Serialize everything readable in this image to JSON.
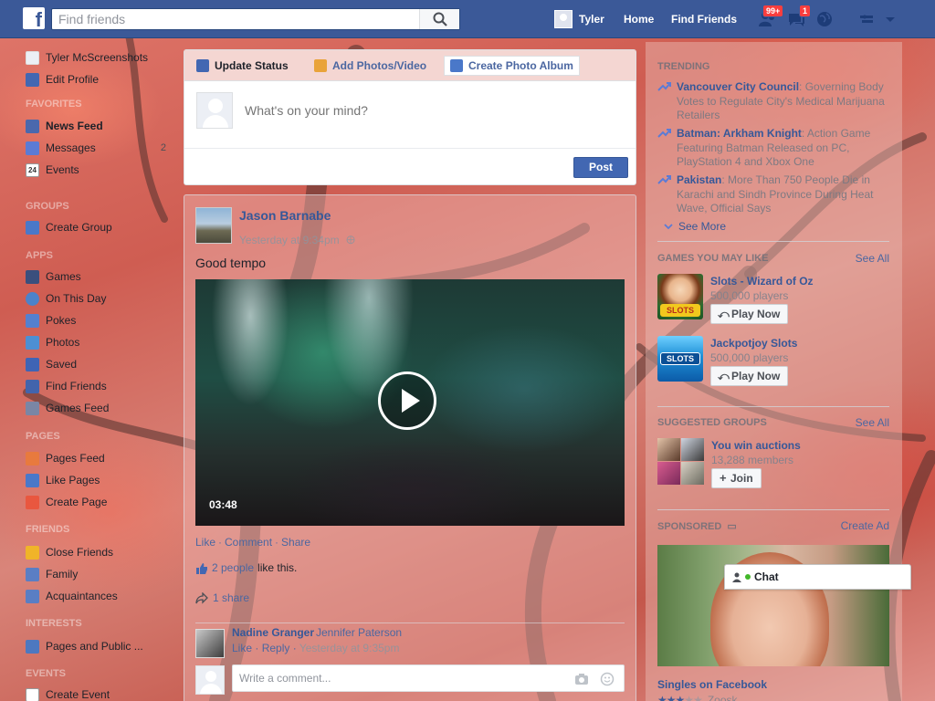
{
  "topbar": {
    "logo": "f",
    "search_placeholder": "Find friends",
    "user_name": "Tyler",
    "home": "Home",
    "find_friends": "Find Friends",
    "friend_requests_badge": "99+",
    "messages_badge": "1",
    "icons": [
      "facebook-logo",
      "search-icon",
      "friend-requests-icon",
      "messages-icon",
      "globe-icon",
      "privacy-icon",
      "caret-down-icon"
    ],
    "brand_color": "#3b5998"
  },
  "left_nav": {
    "profile_name": "Tyler McScreenshots",
    "edit_profile": "Edit Profile",
    "favorites_header": "Favorites",
    "favorites": [
      {
        "label": "News Feed",
        "icon": "news-feed-icon",
        "count": ""
      },
      {
        "label": "Messages",
        "icon": "messages-icon",
        "count": "2"
      },
      {
        "label": "Events",
        "icon": "events-calendar-icon",
        "count": ""
      }
    ],
    "calendar_day": "24",
    "groups_header": "Groups",
    "create_group": "Create Group",
    "apps_header": "Apps",
    "apps": [
      {
        "label": "Games",
        "icon": "games-icon"
      },
      {
        "label": "On This Day",
        "icon": "on-this-day-icon"
      },
      {
        "label": "Pokes",
        "icon": "pokes-icon"
      },
      {
        "label": "Photos",
        "icon": "photos-icon"
      },
      {
        "label": "Saved",
        "icon": "saved-icon"
      },
      {
        "label": "Find Friends",
        "icon": "find-friends-icon"
      },
      {
        "label": "Games Feed",
        "icon": "games-feed-icon"
      }
    ],
    "pages_header": "Pages",
    "pages": [
      {
        "label": "Pages Feed",
        "icon": "pages-feed-icon"
      },
      {
        "label": "Like Pages",
        "icon": "like-pages-icon"
      },
      {
        "label": "Create Page",
        "icon": "create-page-icon"
      }
    ],
    "friends_header": "Friends",
    "friends": [
      {
        "label": "Close Friends",
        "icon": "close-friends-icon"
      },
      {
        "label": "Family",
        "icon": "family-icon"
      },
      {
        "label": "Acquaintances",
        "icon": "acquaintances-icon"
      }
    ],
    "interests_header": "Interests",
    "interests": [
      {
        "label": "Pages and Public ...",
        "icon": "pages-public-icon"
      }
    ],
    "events_header": "Events",
    "create_event": "Create Event"
  },
  "composer": {
    "tab_status": "Update Status",
    "tab_photos": "Add Photos/Video",
    "tab_album": "Create Photo Album",
    "placeholder": "What's on your mind?",
    "post": "Post"
  },
  "story": {
    "author": "Jason Barnabe",
    "time": "Yesterday at 9:34pm",
    "text": "Good tempo",
    "video_duration": "03:48",
    "like": "Like",
    "comment": "Comment",
    "share": "Share",
    "likes_people": "2 people",
    "likes_suffix": "like this.",
    "shares": "1 share",
    "comment_author": "Nadine Granger",
    "comment_text": "Jennifer Paterson",
    "comment_like": "Like",
    "comment_reply": "Reply",
    "comment_time": "Yesterday at 9:35pm",
    "write_placeholder": "Write a comment..."
  },
  "right": {
    "trending_header": "Trending",
    "trending": [
      {
        "topic": "Vancouver City Council",
        "desc": ": Governing Body Votes to Regulate City's Medical Marijuana Retailers"
      },
      {
        "topic": "Batman: Arkham Knight",
        "desc": ": Action Game Featuring Batman Released on PC, PlayStation 4 and Xbox One"
      },
      {
        "topic": "Pakistan",
        "desc": ": More Than 750 People Die in Karachi and Sindh Province During Heat Wave, Official Says"
      }
    ],
    "see_more": "See More",
    "games_header": "Games You May Like",
    "games_see_all": "See All",
    "games": [
      {
        "name": "Slots - Wizard of Oz",
        "players": "500,000 players",
        "button": "Play Now",
        "icon_text": "SLOTS"
      },
      {
        "name": "Jackpotjoy Slots",
        "players": "500,000 players",
        "button": "Play Now",
        "icon_text": "SLOTS"
      }
    ],
    "groups_header": "Suggested Groups",
    "groups_see_all": "See All",
    "group_name": "You win auctions",
    "group_members": "13,288 members",
    "join": "Join",
    "sponsored_header": "Sponsored",
    "create_ad": "Create Ad",
    "ad_title": "Singles on Facebook",
    "ad_rating": 3,
    "ad_rating_max": 5,
    "ad_rating_text": "Zoosk"
  },
  "chat": {
    "label": "Chat"
  }
}
